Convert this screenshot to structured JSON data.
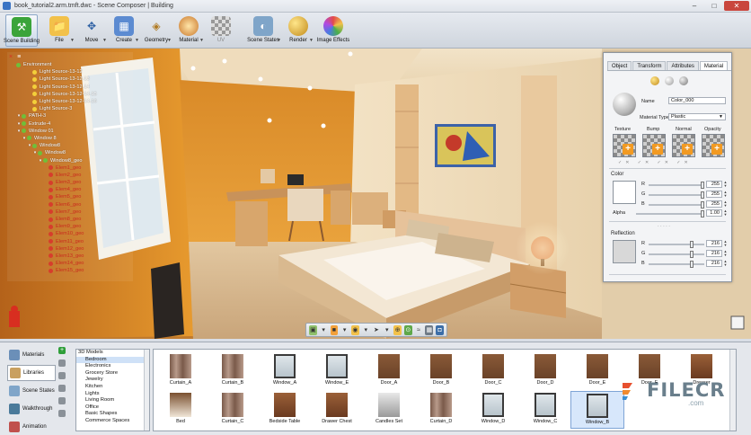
{
  "window": {
    "title": "book_tutorial2.arm.tmft.dwc - Scene Composer | Building"
  },
  "toolbar": {
    "items": [
      {
        "label": "Scene Building"
      },
      {
        "label": "File"
      },
      {
        "label": "Move"
      },
      {
        "label": "Create"
      },
      {
        "label": "Geometry"
      },
      {
        "label": "Material"
      },
      {
        "label": "UV"
      },
      {
        "label": "Scene States"
      },
      {
        "label": "Render"
      },
      {
        "label": "Image Effects"
      }
    ]
  },
  "scene_tree": {
    "header": [
      "×",
      "≡"
    ],
    "rows": [
      {
        "label": "Environment",
        "kind": "env"
      },
      {
        "label": "Light Source-13-12",
        "kind": "light"
      },
      {
        "label": "Light Source-13-12-13",
        "kind": "light"
      },
      {
        "label": "Light Source-13-12-14",
        "kind": "light"
      },
      {
        "label": "Light Source-13-12-14-15",
        "kind": "light"
      },
      {
        "label": "Light Source-13-12-14-16",
        "kind": "light"
      },
      {
        "label": "Light Source-3",
        "kind": "light"
      },
      {
        "label": "PATH-3",
        "kind": "node"
      },
      {
        "label": "Extrude-4",
        "kind": "node"
      },
      {
        "label": "Window 01",
        "kind": "node"
      },
      {
        "label": "Window 8",
        "kind": "node"
      },
      {
        "label": "Window8",
        "kind": "node"
      },
      {
        "label": "Window8",
        "kind": "node"
      },
      {
        "label": "Window8_geo",
        "kind": "node"
      },
      {
        "label": "Elem1_geo",
        "kind": "geo"
      },
      {
        "label": "Elem2_geo",
        "kind": "geo"
      },
      {
        "label": "Elem3_geo",
        "kind": "geo"
      },
      {
        "label": "Elem4_geo",
        "kind": "geo"
      },
      {
        "label": "Elem5_geo",
        "kind": "geo"
      },
      {
        "label": "Elem6_geo",
        "kind": "geo"
      },
      {
        "label": "Elem7_geo",
        "kind": "geo"
      },
      {
        "label": "Elem8_geo",
        "kind": "geo"
      },
      {
        "label": "Elem9_geo",
        "kind": "geo"
      },
      {
        "label": "Elem10_geo",
        "kind": "geo"
      },
      {
        "label": "Elem11_geo",
        "kind": "geo"
      },
      {
        "label": "Elem12_geo",
        "kind": "geo"
      },
      {
        "label": "Elem13_geo",
        "kind": "geo"
      },
      {
        "label": "Elem14_geo",
        "kind": "geo"
      },
      {
        "label": "Elem15_geo",
        "kind": "geo"
      }
    ]
  },
  "properties": {
    "tabs": [
      "Object",
      "Transform",
      "Attributes",
      "Material"
    ],
    "active_tab": "Material",
    "name_label": "Name",
    "name_value": "Color_000",
    "material_type_label": "Material Type",
    "material_type_value": "Plastic",
    "texture_labels": [
      "Texture",
      "Bump",
      "Normal",
      "Opacity"
    ],
    "color_section": "Color",
    "color_channels": [
      {
        "label": "R",
        "value": "255"
      },
      {
        "label": "G",
        "value": "255"
      },
      {
        "label": "B",
        "value": "255"
      }
    ],
    "alpha_label": "Alpha",
    "alpha_value": "1.00",
    "reflection_section": "Reflection",
    "reflection_channels": [
      {
        "label": "R",
        "value": "216"
      },
      {
        "label": "G",
        "value": "216"
      },
      {
        "label": "B",
        "value": "216"
      }
    ]
  },
  "library": {
    "tabs": [
      {
        "label": "Materials"
      },
      {
        "label": "Libraries"
      },
      {
        "label": "Scene States"
      },
      {
        "label": "Walkthrough"
      },
      {
        "label": "Animation"
      }
    ],
    "active_tab": "Libraries",
    "categories": [
      {
        "label": "3D Models",
        "root": true
      },
      {
        "label": "Bedroom",
        "selected": true
      },
      {
        "label": "Electronics"
      },
      {
        "label": "Grocery Store"
      },
      {
        "label": "Jewelry"
      },
      {
        "label": "Kitchen"
      },
      {
        "label": "Lights"
      },
      {
        "label": "Living Room"
      },
      {
        "label": "Office"
      },
      {
        "label": "Basic Shapes"
      },
      {
        "label": "Commerce Spaces"
      }
    ],
    "items_row1": [
      "Curtain_A",
      "Curtain_B",
      "Window_A",
      "Window_E",
      "Door_A",
      "Door_B",
      "Door_C",
      "Door_D",
      "Door_E",
      "Door_F",
      "Dresser"
    ],
    "items_row2": [
      "Bed",
      "Curtain_C",
      "Bedside Table",
      "Drawer Chest",
      "Candles Set",
      "Curtain_D",
      "Window_D",
      "Window_C",
      "Window_B"
    ],
    "selected_item": "Window_B"
  },
  "watermark": {
    "text": "FILECR",
    "sub": ".com"
  },
  "colors": {
    "accent": "#f29a22",
    "wall_orange": "#d9841e",
    "panel_bg": "#f3f4f6"
  }
}
